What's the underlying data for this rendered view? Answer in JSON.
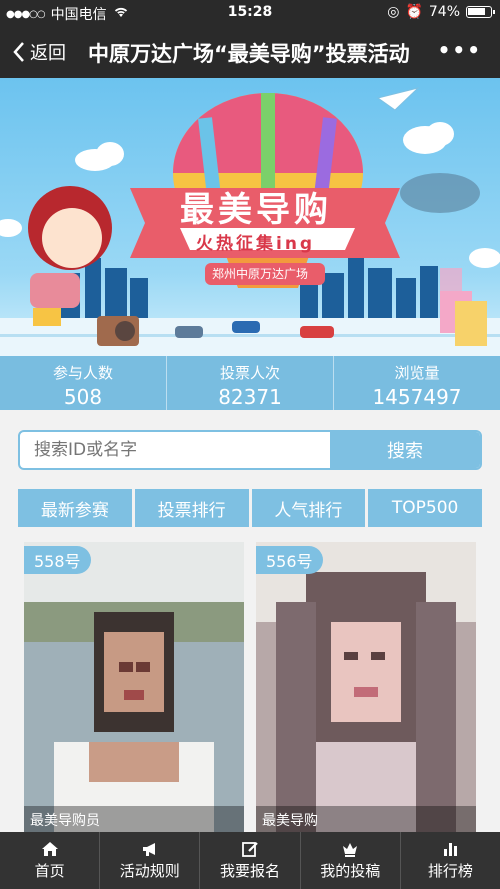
{
  "status_bar": {
    "carrier": "中国电信",
    "time": "15:28",
    "battery": "74%"
  },
  "nav": {
    "back_label": "返回",
    "title": "中原万达广场“最美导购”投票活动",
    "more": "•••"
  },
  "banner": {
    "headline": "最美导购",
    "subline": "火热征集ing",
    "brand": "郑州中原万达广场"
  },
  "stats": [
    {
      "label": "参与人数",
      "value": "508"
    },
    {
      "label": "投票人次",
      "value": "82371"
    },
    {
      "label": "浏览量",
      "value": "1457497"
    }
  ],
  "search": {
    "placeholder": "搜索ID或名字",
    "button": "搜索"
  },
  "tabs": [
    "最新参赛",
    "投票排行",
    "人气排行",
    "TOP500"
  ],
  "cards": [
    {
      "number": "558号",
      "caption": "最美导购员"
    },
    {
      "number": "556号",
      "caption": "最美导购"
    }
  ],
  "tabbar": [
    {
      "label": "首页",
      "icon": "home-icon"
    },
    {
      "label": "活动规则",
      "icon": "megaphone-icon"
    },
    {
      "label": "我要报名",
      "icon": "edit-icon"
    },
    {
      "label": "我的投稿",
      "icon": "crown-icon"
    },
    {
      "label": "排行榜",
      "icon": "bar-chart-icon"
    }
  ],
  "colors": {
    "accent": "#7ec0e2",
    "stats_bg": "#79bde0",
    "dark": "#2a2a2a"
  }
}
